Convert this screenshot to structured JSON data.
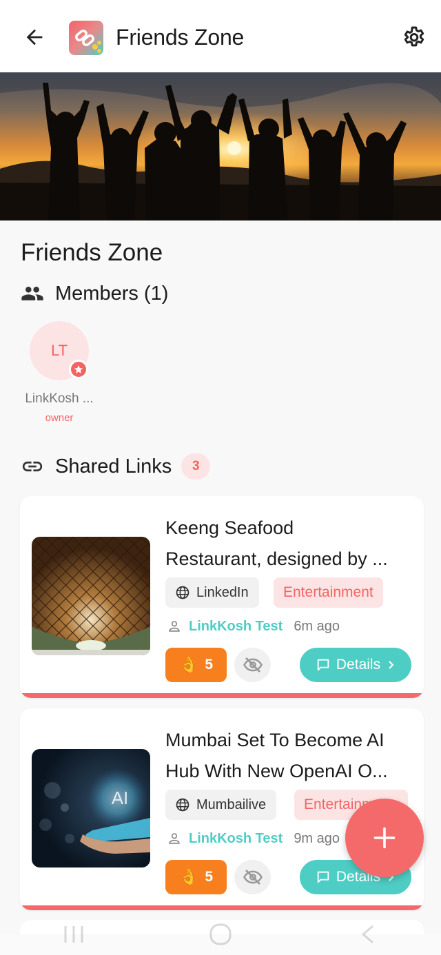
{
  "appbar": {
    "title": "Friends Zone",
    "icons": {
      "back": "arrow-left-icon",
      "logo": "link-share-logo",
      "settings": "gear-icon"
    }
  },
  "group": {
    "name": "Friends Zone",
    "members_label": "Members (1)",
    "members": [
      {
        "initials": "LT",
        "name": "LinkKosh ...",
        "role": "owner",
        "badge_icon": "star-icon"
      }
    ]
  },
  "shared_links": {
    "label": "Shared Links",
    "count": "3",
    "items": [
      {
        "title_line1": "Keeng Seafood",
        "title_line2": "Restaurant, designed by ...",
        "source": "LinkedIn",
        "category": "Entertainment",
        "author": "LinkKosh Test",
        "time": "6m ago",
        "reactions": "5",
        "details_label": "Details",
        "thumb": "bamboo-lattice-architecture"
      },
      {
        "title_line1": "Mumbai Set To Become AI",
        "title_line2": "Hub With New OpenAI O...",
        "source": "Mumbailive",
        "category": "Entertainment",
        "author": "LinkKosh Test",
        "time": "9m ago",
        "reactions": "5",
        "details_label": "Details",
        "thumb": "ai-hologram-hand"
      }
    ]
  },
  "fab": {
    "icon": "plus-icon"
  },
  "system_nav": {
    "icons": [
      "recent-apps-icon",
      "home-icon",
      "back-nav-icon"
    ]
  },
  "colors": {
    "accent": "#f46a6a",
    "teal": "#4ecdc4",
    "orange": "#f77f1e",
    "pink_bg": "#fde4e4"
  }
}
